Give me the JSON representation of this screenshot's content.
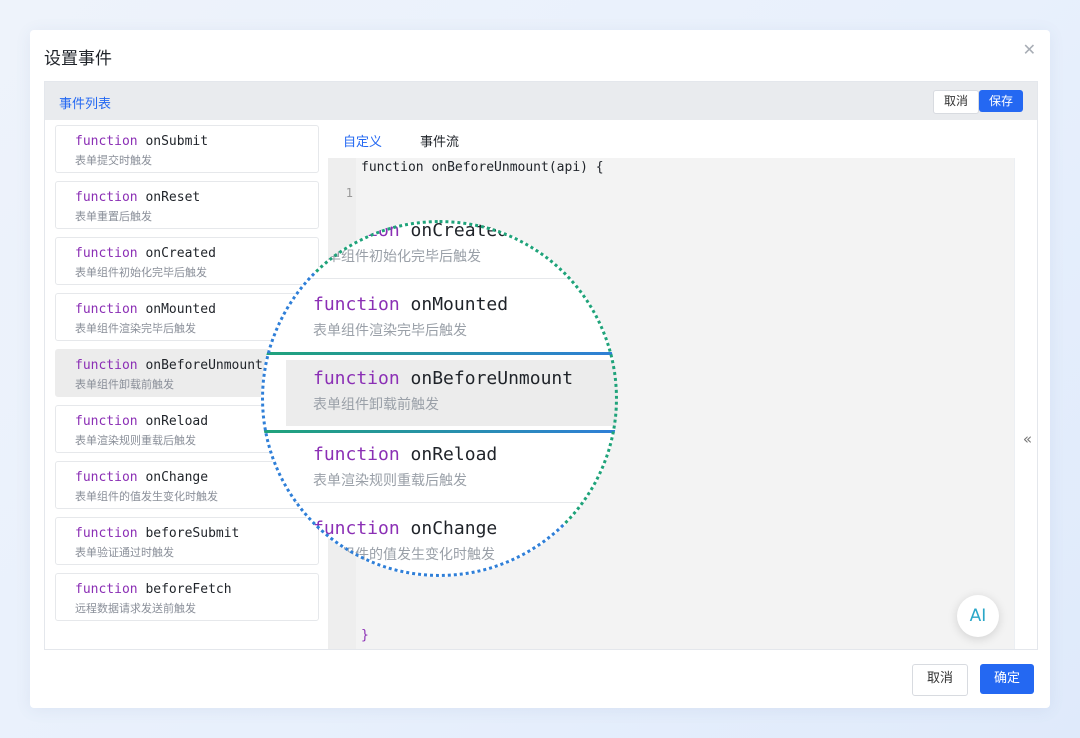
{
  "dialog": {
    "title": "设置事件",
    "close_icon": "close-icon"
  },
  "panel": {
    "title": "事件列表",
    "cancel_label": "取消",
    "save_label": "保存"
  },
  "keyword": "function",
  "events": [
    {
      "name": "onSubmit",
      "desc": "表单提交时触发"
    },
    {
      "name": "onReset",
      "desc": "表单重置后触发"
    },
    {
      "name": "onCreated",
      "desc": "表单组件初始化完毕后触发"
    },
    {
      "name": "onMounted",
      "desc": "表单组件渲染完毕后触发"
    },
    {
      "name": "onBeforeUnmount",
      "desc": "表单组件卸载前触发"
    },
    {
      "name": "onReload",
      "desc": "表单渲染规则重载后触发"
    },
    {
      "name": "onChange",
      "desc": "表单组件的值发生变化时触发"
    },
    {
      "name": "beforeSubmit",
      "desc": "表单验证通过时触发"
    },
    {
      "name": "beforeFetch",
      "desc": "远程数据请求发送前触发"
    }
  ],
  "active_event": "onBeforeUnmount",
  "editor": {
    "tabs": [
      "自定义",
      "事件流"
    ],
    "active_tab": "自定义",
    "code_first_line": "function onBeforeUnmount(api) {",
    "line_number": "1",
    "code_last_line": "}",
    "collapse_icon": "«"
  },
  "ai_label": "AI",
  "footer": {
    "cancel_label": "取消",
    "ok_label": "确定"
  },
  "colors": {
    "accent": "#2468f2",
    "keyword": "#8b2fb5",
    "ring_top": "#1fa37a",
    "ring_bottom": "#2f7fd8"
  }
}
